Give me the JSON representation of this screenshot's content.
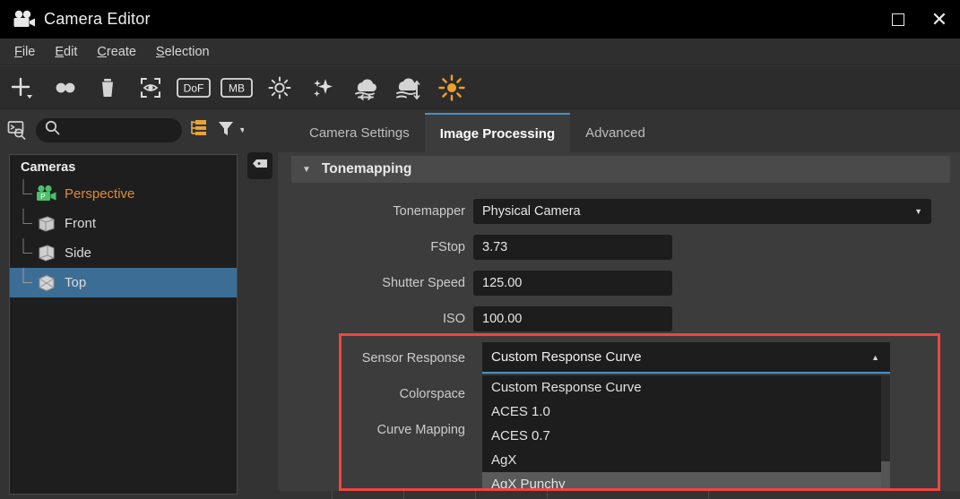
{
  "window": {
    "title": "Camera Editor",
    "icon": "movie-camera-icon",
    "maximize_label": "",
    "close_label": ""
  },
  "menubar": {
    "items": [
      {
        "label": "File",
        "mnemonic": "F"
      },
      {
        "label": "Edit",
        "mnemonic": "E"
      },
      {
        "label": "Create",
        "mnemonic": "C"
      },
      {
        "label": "Selection",
        "mnemonic": "S"
      }
    ]
  },
  "toolbar": {
    "items": [
      {
        "name": "add-camera-button",
        "icon": "plus-with-dropdown-icon",
        "label": ""
      },
      {
        "name": "duplicate-button",
        "icon": "two-circles-icon",
        "label": ""
      },
      {
        "name": "delete-button",
        "icon": "trash-icon",
        "label": ""
      },
      {
        "name": "look-through-button",
        "icon": "eye-in-brackets-icon",
        "label": ""
      },
      {
        "name": "depth-of-field-button",
        "icon": "dof-badge-icon",
        "label": "DoF"
      },
      {
        "name": "motion-blur-button",
        "icon": "mb-badge-icon",
        "label": "MB"
      },
      {
        "name": "exposure-button",
        "icon": "sun-small-icon",
        "label": ""
      },
      {
        "name": "sparkle-button",
        "icon": "sparkles-icon",
        "label": ""
      },
      {
        "name": "fog-horizontal-button",
        "icon": "cloud-horizontal-arrows-icon",
        "label": ""
      },
      {
        "name": "fog-vertical-button",
        "icon": "cloud-vertical-arrows-icon",
        "label": ""
      },
      {
        "name": "sunlight-button",
        "icon": "sun-burst-icon",
        "label": ""
      }
    ]
  },
  "left_panel": {
    "console_icon": "console-search-icon",
    "search": {
      "value": "",
      "placeholder": ""
    },
    "hierarchy_icon": "hierarchy-orange-icon",
    "filter_icon": "filter-funnel-icon",
    "filter_caret": "▼",
    "tree": {
      "header": "Cameras",
      "items": [
        {
          "label": "Perspective",
          "icon": "camera-green-icon",
          "selected": false,
          "accent": true
        },
        {
          "label": "Front",
          "icon": "cube-front-icon",
          "selected": false,
          "accent": false
        },
        {
          "label": "Side",
          "icon": "cube-side-icon",
          "selected": false,
          "accent": false
        },
        {
          "label": "Top",
          "icon": "cube-top-icon",
          "selected": true,
          "accent": false
        }
      ]
    },
    "tag_button_icon": "tag-collapse-icon"
  },
  "main_panel": {
    "tabs": [
      {
        "label": "Camera Settings",
        "active": false
      },
      {
        "label": "Image Processing",
        "active": true
      },
      {
        "label": "Advanced",
        "active": false
      }
    ],
    "section": {
      "caret": "▼",
      "title": "Tonemapping"
    },
    "fields": [
      {
        "label": "Tonemapper",
        "value": "Physical Camera",
        "type": "combo"
      },
      {
        "label": "FStop",
        "value": "3.73",
        "type": "number"
      },
      {
        "label": "Shutter Speed",
        "value": "125.00",
        "type": "number"
      },
      {
        "label": "ISO",
        "value": "100.00",
        "type": "number"
      }
    ],
    "open_combo": {
      "label": "Sensor Response",
      "value": "Custom Response Curve",
      "caret_up": "▲",
      "options": [
        {
          "label": "Custom Response Curve",
          "highlight": false
        },
        {
          "label": "ACES 1.0",
          "highlight": false
        },
        {
          "label": "ACES 0.7",
          "highlight": false
        },
        {
          "label": "AgX",
          "highlight": false
        },
        {
          "label": "AgX Punchy",
          "highlight": true
        }
      ]
    },
    "obscured_labels": [
      {
        "label": "Colorspace"
      },
      {
        "label": "Curve Mapping"
      }
    ]
  },
  "annotation": {
    "color": "#f0453f",
    "name": "red-highlight-box"
  },
  "colors": {
    "accent_orange": "#e08a3c",
    "tab_underline_blue": "#4a90c4",
    "selection_blue": "#3c6e95",
    "panel_bg": "#3c3c3c",
    "field_bg": "#1d1d1d"
  }
}
